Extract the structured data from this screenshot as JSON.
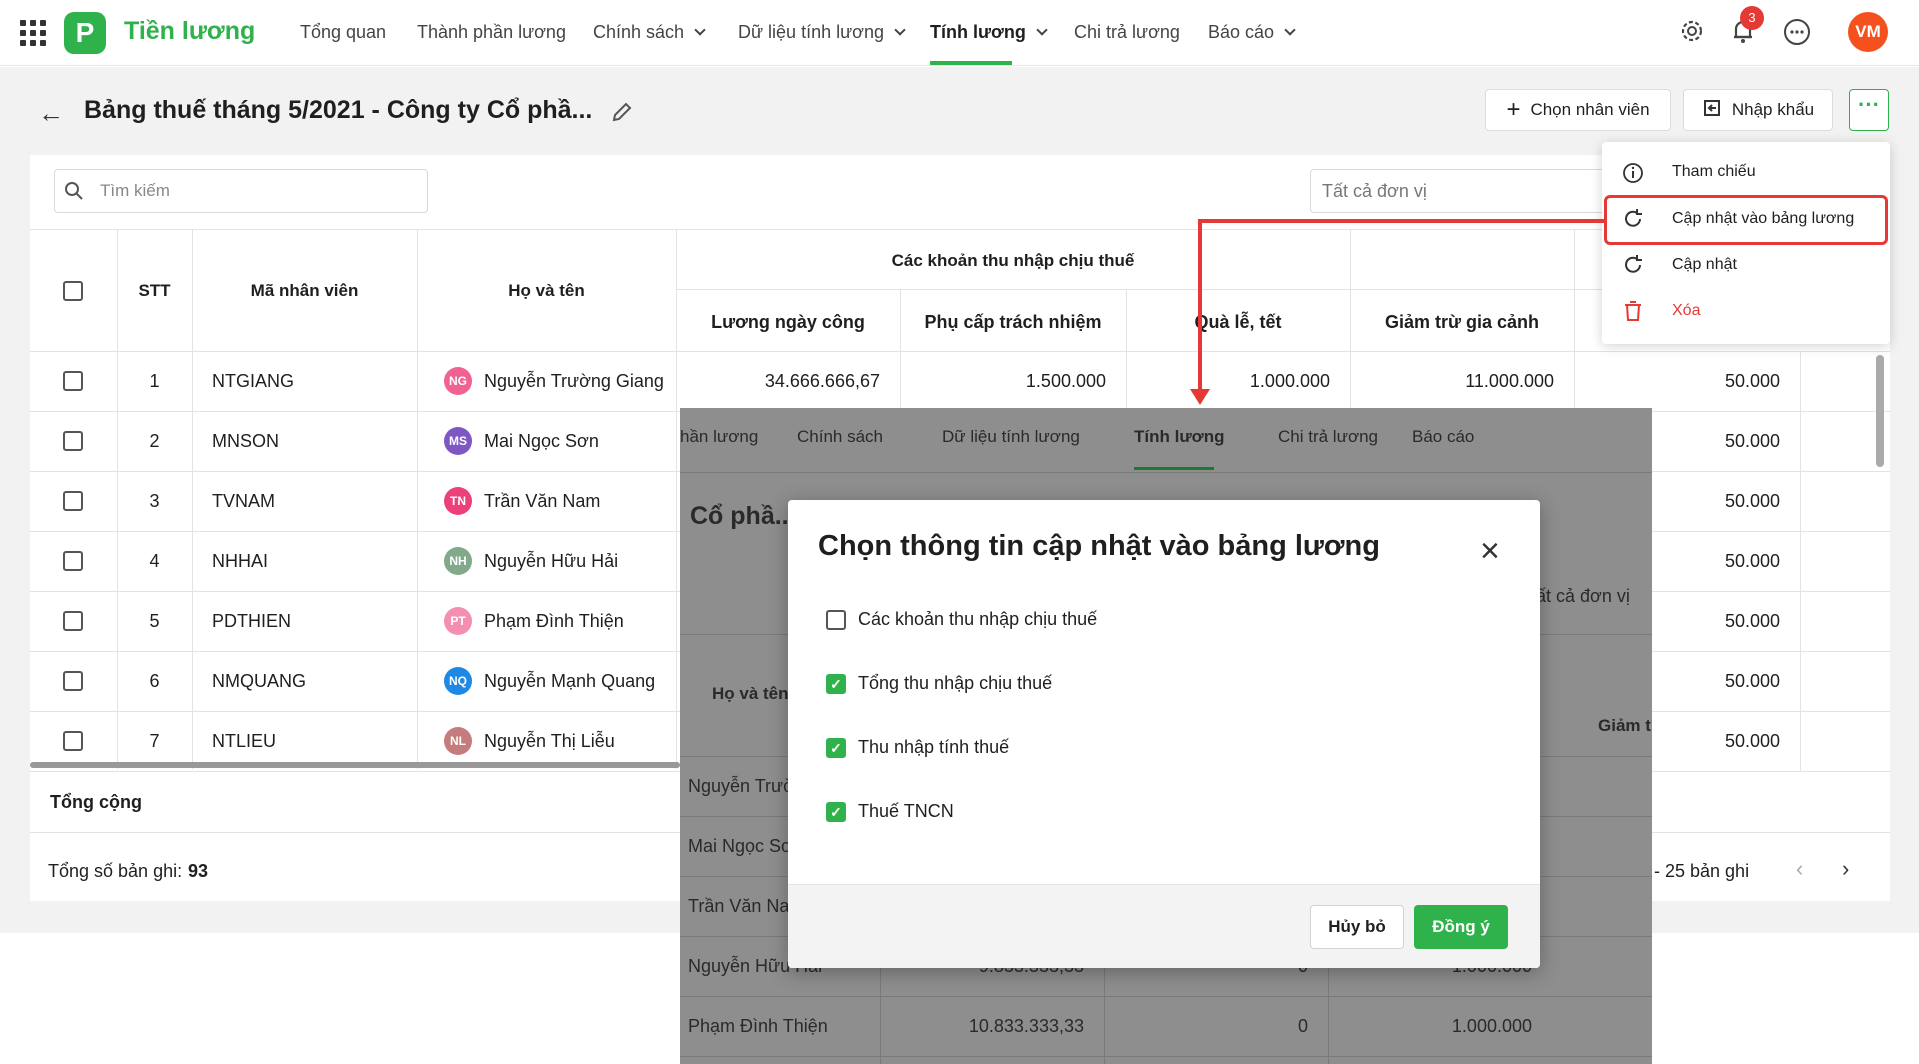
{
  "app": {
    "name": "Tiền lương",
    "logo_letter": "P"
  },
  "nav": {
    "items": [
      {
        "label": "Tổng quan",
        "dropdown": false
      },
      {
        "label": "Thành phần lương",
        "dropdown": false
      },
      {
        "label": "Chính sách",
        "dropdown": true
      },
      {
        "label": "Dữ liệu tính lương",
        "dropdown": true
      },
      {
        "label": "Tính lương",
        "dropdown": true,
        "active": true
      },
      {
        "label": "Chi trả lương",
        "dropdown": false
      },
      {
        "label": "Báo cáo",
        "dropdown": true
      }
    ],
    "notification_count": "3",
    "user_initials": "VM"
  },
  "page": {
    "title": "Bảng thuế tháng 5/2021 - Công ty Cổ phầ...",
    "add_employee_label": "Chọn nhân viên",
    "import_label": "Nhập khẩu",
    "more_label": "···"
  },
  "filters": {
    "search_placeholder": "Tìm kiếm",
    "unit_placeholder": "Tất cả đơn vị"
  },
  "table": {
    "headers": {
      "stt": "STT",
      "employee_code": "Mã nhân viên",
      "full_name": "Họ và tên",
      "taxable_income_group": "Các khoản thu nhập chịu thuế",
      "daily_wage": "Lương ngày công",
      "responsibility_allowance": "Phụ cấp trách nhiệm",
      "holiday_gift": "Quà lễ, tết",
      "family_deduction": "Giảm trừ gia cảnh"
    },
    "rows": [
      {
        "stt": "1",
        "code": "NTGIANG",
        "initials": "NG",
        "avatar_color": "#f06292",
        "name": "Nguyễn Trường Giang",
        "daily_wage": "34.666.666,67",
        "allowance": "1.500.000",
        "gift": "1.000.000",
        "deduction": "11.000.000",
        "last": "50.000"
      },
      {
        "stt": "2",
        "code": "MNSON",
        "initials": "MS",
        "avatar_color": "#7e57c2",
        "name": "Mai Ngọc Sơn",
        "daily_wage": "",
        "allowance": "",
        "gift": "",
        "deduction": "",
        "last": "50.000"
      },
      {
        "stt": "3",
        "code": "TVNAM",
        "initials": "TN",
        "avatar_color": "#ec407a",
        "name": "Trần Văn Nam",
        "daily_wage": "",
        "allowance": "",
        "gift": "",
        "deduction": "",
        "last": "50.000"
      },
      {
        "stt": "4",
        "code": "NHHAI",
        "initials": "NH",
        "avatar_color": "#81a98a",
        "name": "Nguyễn Hữu Hải",
        "daily_wage": "",
        "allowance": "",
        "gift": "",
        "deduction": "",
        "last": "50.000"
      },
      {
        "stt": "5",
        "code": "PDTHIEN",
        "initials": "PT",
        "avatar_color": "#f48fb1",
        "name": "Phạm Đình Thiện",
        "daily_wage": "",
        "allowance": "",
        "gift": "",
        "deduction": "",
        "last": "50.000"
      },
      {
        "stt": "6",
        "code": "NMQUANG",
        "initials": "NQ",
        "avatar_color": "#1e88e5",
        "name": "Nguyễn Mạnh Quang",
        "daily_wage": "",
        "allowance": "",
        "gift": "",
        "deduction": "",
        "last": "50.000"
      },
      {
        "stt": "7",
        "code": "NTLIEU",
        "initials": "NL",
        "avatar_color": "#c47c7c",
        "name": "Nguyễn Thị Liễu",
        "daily_wage": "",
        "allowance": "",
        "gift": "",
        "deduction": "",
        "last": "50.000"
      }
    ],
    "total_label": "Tổng cộng",
    "record_count_label": "Tổng số bản ghi:",
    "record_count": "93",
    "page_size_label": "- 25 bản ghi"
  },
  "menu": {
    "items": [
      {
        "label": "Tham chiếu",
        "icon": "info-icon"
      },
      {
        "label": "Cập nhật vào bảng lương",
        "icon": "refresh-icon",
        "highlighted": true
      },
      {
        "label": "Cập nhật",
        "icon": "refresh-icon"
      },
      {
        "label": "Xóa",
        "icon": "trash-icon",
        "color": "#e53935"
      }
    ]
  },
  "inset": {
    "nav": [
      "hần lương",
      "Chính sách",
      "Dữ liệu tính lương",
      "Tính lương",
      "Chi trả lương",
      "Báo cáo"
    ],
    "title_fragment": "Cổ phầ...",
    "unit_fragment": "ất cả đơn vị",
    "header_name": "Họ và tên",
    "header_deduction": "Giảm t",
    "names": [
      "Nguyễn Trườ",
      "Mai Ngọc Sơ",
      "Trần Văn Na",
      "Nguyễn Hữu Hải",
      "Phạm Đình Thiện"
    ],
    "row_values": {
      "daily_wage": "10.833.333,33",
      "allowance": "0",
      "gift": "1.000.000"
    },
    "row4_fragment": [
      "9.833.333,33",
      "0",
      "1.000.000"
    ]
  },
  "dialog": {
    "title": "Chọn thông tin cập nhật vào bảng lương",
    "options": [
      {
        "label": "Các khoản thu nhập chịu thuế",
        "checked": false
      },
      {
        "label": "Tổng thu nhập chịu thuế",
        "checked": true
      },
      {
        "label": "Thu nhập tính thuế",
        "checked": true
      },
      {
        "label": "Thuế TNCN",
        "checked": true
      }
    ],
    "cancel_label": "Hủy bỏ",
    "ok_label": "Đồng ý"
  }
}
